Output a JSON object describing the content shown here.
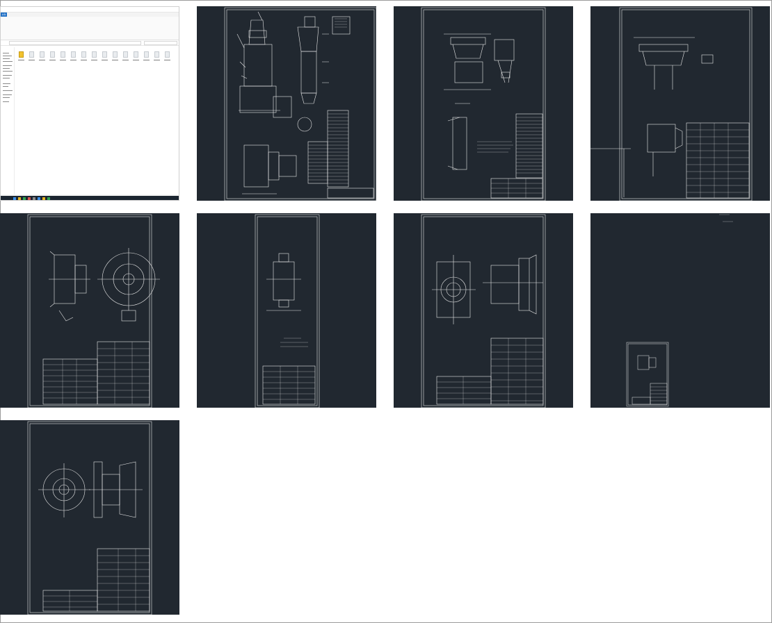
{
  "page": {
    "background": "#ffffff",
    "tile_background": "#212830",
    "line_color": "#e8e8e8"
  },
  "explorer": {
    "window_title": "",
    "file_tab_label": "文件",
    "file_count": 15,
    "selected_file_index": 0
  },
  "drawings": [
    {
      "name": "assembly-general"
    },
    {
      "name": "assembly-section"
    },
    {
      "name": "assembly-side"
    },
    {
      "name": "pulley-assembly"
    },
    {
      "name": "shaft-part"
    },
    {
      "name": "flange-assembly"
    },
    {
      "name": "small-sheet"
    },
    {
      "name": "bearing-seat-assembly"
    }
  ]
}
